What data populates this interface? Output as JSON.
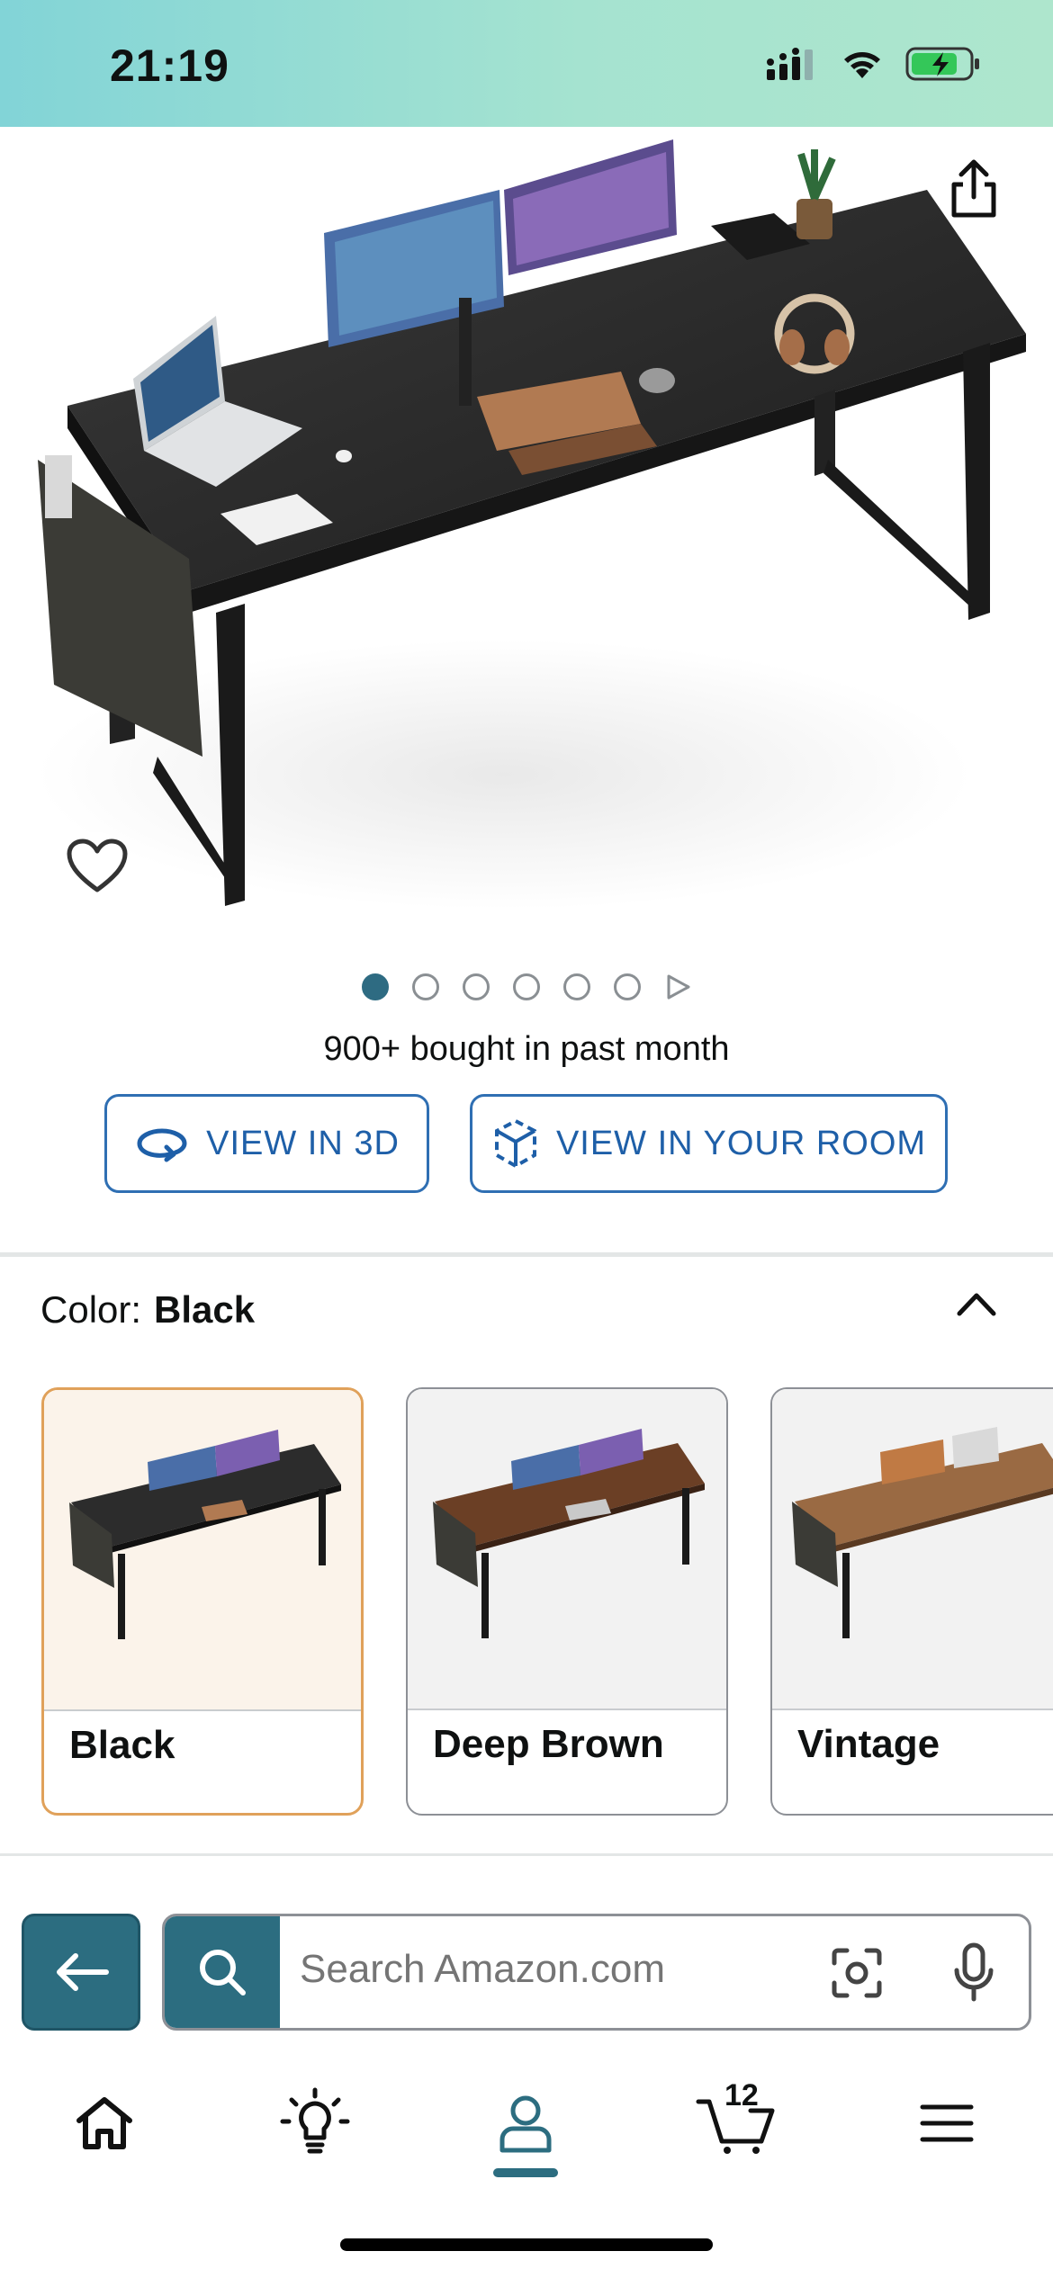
{
  "status_bar": {
    "time": "21:19"
  },
  "product": {
    "image_alt": "Black computer desk with monitors, laptop and accessories",
    "carousel": {
      "current": 1,
      "total": 6
    },
    "bought_text": "900+ bought in past month",
    "view_3d_label": "VIEW IN 3D",
    "view_room_label": "VIEW IN YOUR ROOM"
  },
  "color_selector": {
    "label": "Color:",
    "selected": "Black",
    "options": [
      {
        "label": "Black",
        "selected": true,
        "desk_color": "#2c2c2c"
      },
      {
        "label": "Deep Brown",
        "selected": false,
        "desk_color": "#6b3f25"
      },
      {
        "label": "Vintage",
        "selected": false,
        "desk_color": "#9a6a43"
      }
    ]
  },
  "search": {
    "placeholder": "Search Amazon.com"
  },
  "tabbar": {
    "items": [
      "home-icon",
      "lightbulb-icon",
      "account-icon",
      "cart-icon",
      "menu-icon"
    ],
    "active": "account-icon",
    "cart_count": "12"
  },
  "colors": {
    "accent": "#2c6d80",
    "link": "#1e5fa8",
    "selected_border": "#e0a15a"
  }
}
